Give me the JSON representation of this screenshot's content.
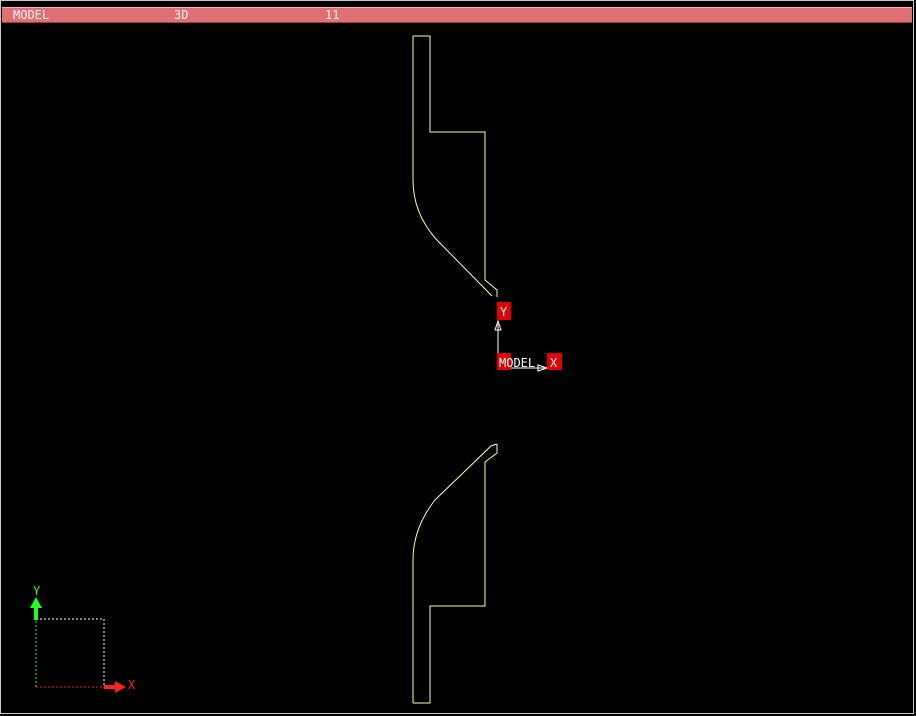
{
  "status_bar": {
    "space": "MODEL",
    "view": "3D",
    "count": "11"
  },
  "ucs_icon": {
    "x_label": "X",
    "y_label": "Y"
  },
  "origin_marker": {
    "x_label": "X",
    "y_label": "Y",
    "label": "MODEL"
  },
  "colors": {
    "background": "#000000",
    "status_bar": "#de7074",
    "geometry": "#ffff99",
    "ucs_x_axis": "#ff2020",
    "ucs_y_axis": "#20ff20",
    "marker_badge": "#e00000"
  }
}
